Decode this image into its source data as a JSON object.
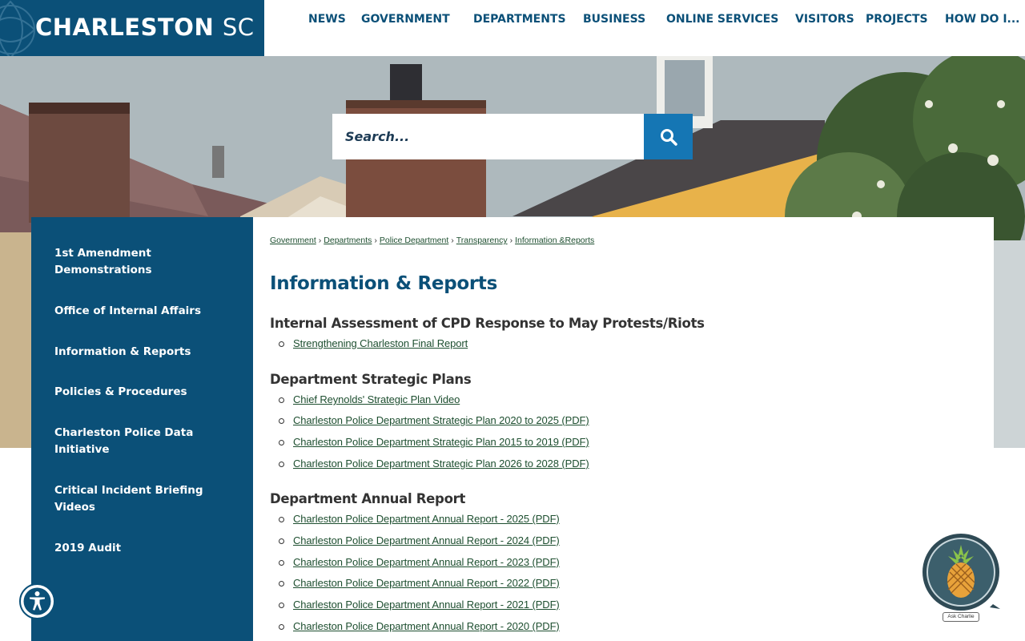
{
  "header": {
    "logo_main": "CHARLESTON",
    "logo_suffix": "SC",
    "nav": [
      "NEWS",
      "GOVERNMENT",
      "DEPARTMENTS",
      "BUSINESS",
      "ONLINE SERVICES",
      "VISITORS",
      "PROJECTS",
      "HOW DO I..."
    ]
  },
  "search": {
    "placeholder": "Search..."
  },
  "sidebar": {
    "items": [
      "1st Amendment Demonstrations",
      "Office of Internal Affairs",
      "Information & Reports",
      "Policies & Procedures",
      "Charleston Police Data Initiative",
      "Critical Incident Briefing Videos",
      "2019 Audit"
    ]
  },
  "breadcrumb": [
    "Government",
    "Departments",
    "Police Department",
    "Transparency",
    "Information &Reports"
  ],
  "page_title": "Information & Reports",
  "sections": [
    {
      "heading": "Internal Assessment of CPD Response to May Protests/Riots",
      "links": [
        "Strengthening Charleston Final Report"
      ]
    },
    {
      "heading": "Department Strategic Plans",
      "links": [
        "Chief Reynolds' Strategic Plan Video",
        "Charleston Police Department Strategic Plan 2020 to 2025 (PDF)",
        "Charleston Police Department Strategic Plan 2015 to 2019 (PDF)",
        "Charleston Police Department Strategic Plan 2026 to 2028 (PDF)"
      ]
    },
    {
      "heading": "Department Annual Report",
      "links": [
        "Charleston Police Department Annual Report - 2025 (PDF)",
        "Charleston Police Department Annual Report - 2024 (PDF)",
        "Charleston Police Department Annual Report - 2023 (PDF)",
        "Charleston Police Department Annual Report - 2022 (PDF)",
        "Charleston Police Department Annual Report - 2021 (PDF)",
        "Charleston Police Department Annual Report - 2020 (PDF)"
      ]
    }
  ],
  "chatbot": {
    "label": "Ask Charlie"
  },
  "icons": {
    "search": "search-icon",
    "accessibility": "accessibility-icon",
    "chatbot": "pineapple-icon"
  },
  "colors": {
    "brand_blue": "#0b5078",
    "search_button": "#1576b4",
    "link_green": "#1e4f30"
  }
}
